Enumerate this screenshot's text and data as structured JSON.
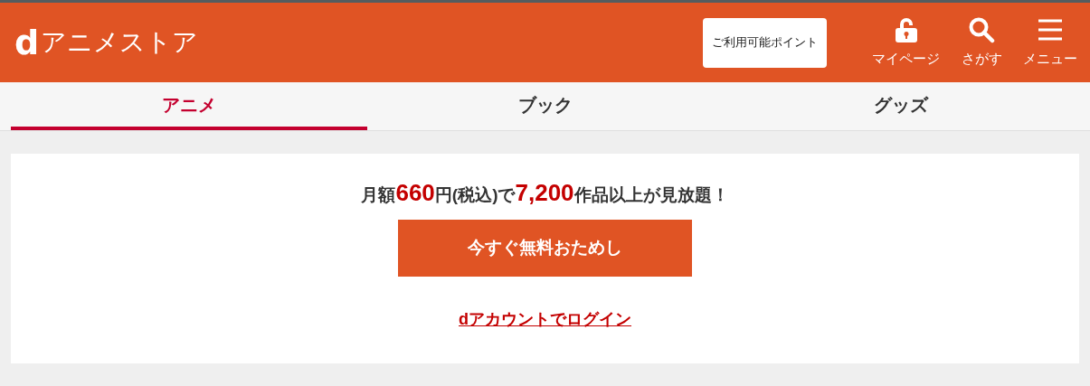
{
  "header": {
    "logo": {
      "mark": "d",
      "name": "アニメストア"
    },
    "points_button": "ご利用可能ポイント",
    "nav": [
      {
        "kind": "lock",
        "label": "マイページ"
      },
      {
        "kind": "search",
        "label": "さがす"
      },
      {
        "kind": "menu",
        "label": "メニュー"
      }
    ]
  },
  "tabs": [
    {
      "label": "アニメ",
      "selected": true
    },
    {
      "label": "ブック",
      "selected": false
    },
    {
      "label": "グッズ",
      "selected": false
    }
  ],
  "promo": {
    "headline": [
      {
        "kind": "plain",
        "text": "月額"
      },
      {
        "kind": "highlight",
        "text": "660"
      },
      {
        "kind": "plain",
        "text": "円(税込)で"
      },
      {
        "kind": "highlight",
        "text": "7,200"
      },
      {
        "kind": "plain",
        "text": "作品以上が見放題！"
      }
    ],
    "trial_button": "今すぐ無料おためし",
    "login_link": "dアカウントでログイン"
  }
}
